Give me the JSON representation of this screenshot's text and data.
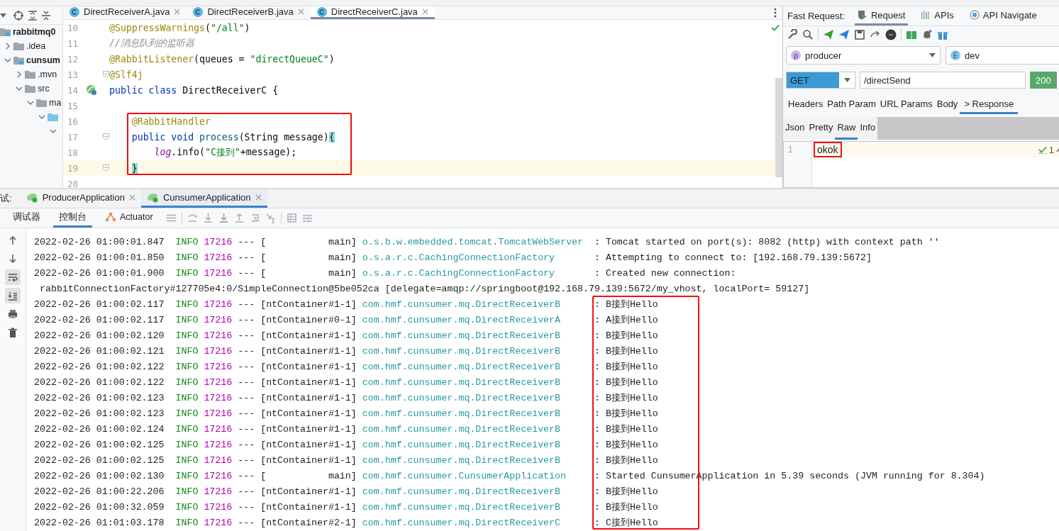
{
  "project_tree": {
    "items": [
      {
        "label": "rabbitmq0",
        "bold": true,
        "kind": "module",
        "children": [
          {
            "label": ".idea",
            "bold": false,
            "kind": "folder",
            "expanded": false
          },
          {
            "label": "cunsum",
            "bold": true,
            "kind": "module",
            "expanded": true,
            "children": [
              {
                "label": ".mvn",
                "bold": false,
                "kind": "folder",
                "expanded": false
              },
              {
                "label": "src",
                "bold": false,
                "kind": "folder",
                "expanded": true,
                "children": [
                  {
                    "label": "ma",
                    "bold": false,
                    "kind": "folder",
                    "expanded": true,
                    "children": [
                      {
                        "kind": "source",
                        "expanded": true,
                        "children": [
                          {
                            "expanded": true
                          }
                        ]
                      }
                    ]
                  }
                ]
              }
            ]
          }
        ]
      }
    ]
  },
  "editor": {
    "tabs": [
      {
        "label": "DirectReceiverA.java",
        "selected": false
      },
      {
        "label": "DirectReceiverB.java",
        "selected": false
      },
      {
        "label": "DirectReceiverC.java",
        "selected": true
      }
    ],
    "lines": [
      {
        "number": "10",
        "current": false,
        "fold": false,
        "gutter_marker": false,
        "tokens": [
          {
            "kind": "annotation",
            "text": "@SuppressWarnings"
          },
          {
            "kind": "plain",
            "text": "("
          },
          {
            "kind": "string",
            "text": "\"/all\""
          },
          {
            "kind": "plain",
            "text": ")"
          }
        ]
      },
      {
        "number": "11",
        "current": false,
        "fold": false,
        "gutter_marker": false,
        "tokens": [
          {
            "kind": "comment",
            "text": "//消息队列的监听器"
          }
        ]
      },
      {
        "number": "12",
        "current": false,
        "fold": false,
        "gutter_marker": false,
        "tokens": [
          {
            "kind": "annotation",
            "text": "@RabbitListener"
          },
          {
            "kind": "plain",
            "text": "(queues = "
          },
          {
            "kind": "string",
            "text": "\"directQueueC\""
          },
          {
            "kind": "plain",
            "text": ")"
          }
        ]
      },
      {
        "number": "13",
        "current": false,
        "fold": true,
        "gutter_marker": false,
        "tokens": [
          {
            "kind": "annotation",
            "text": "@Slf4j"
          }
        ]
      },
      {
        "number": "14",
        "current": false,
        "fold": false,
        "gutter_marker": true,
        "tokens": [
          {
            "kind": "keyword",
            "text": "public class "
          },
          {
            "kind": "plain",
            "text": "DirectReceiverC {"
          }
        ]
      },
      {
        "number": "15",
        "current": false,
        "fold": false,
        "gutter_marker": false
      }
    ],
    "highlighted_lines": [
      {
        "number": "16",
        "current": false,
        "fold": false,
        "gutter_marker": false,
        "tokens": [
          {
            "kind": "annotation",
            "text": "    @RabbitHandler"
          }
        ]
      },
      {
        "number": "17",
        "current": false,
        "fold": true,
        "gutter_marker": false,
        "tokens": [
          {
            "kind": "keyword",
            "text": "    public void "
          },
          {
            "kind": "method",
            "text": "process"
          },
          {
            "kind": "plain",
            "text": "(String message)"
          },
          {
            "kind": "brace",
            "text": "{"
          }
        ]
      },
      {
        "number": "18",
        "current": false,
        "fold": false,
        "gutter_marker": false,
        "tokens": [
          {
            "kind": "field",
            "text": "        log"
          },
          {
            "kind": "plain",
            "text": ".info("
          },
          {
            "kind": "string",
            "text": "\"C接到\""
          },
          {
            "kind": "plain",
            "text": "+message);"
          }
        ]
      },
      {
        "number": "19",
        "current": true,
        "fold": true,
        "gutter_marker": false,
        "tokens": [
          {
            "kind": "brace",
            "text": "    }"
          }
        ]
      }
    ],
    "lines_after": [
      {
        "number": "20",
        "current": false,
        "fold": false,
        "gutter_marker": false
      }
    ]
  },
  "fast_request": {
    "label": "Fast Request:",
    "tabs": [
      {
        "label": "Request",
        "selected": true,
        "kind": "request"
      },
      {
        "label": "APIs",
        "selected": false,
        "kind": "apis"
      },
      {
        "label": "API Navigate",
        "selected": false,
        "kind": "navigate"
      }
    ],
    "project": {
      "badge": "p",
      "value": "producer"
    },
    "environment": {
      "badge": "E",
      "value": "dev"
    },
    "method": "GET",
    "url": "/directSend",
    "send_button": "200",
    "request_tabs": [
      {
        "label": "Headers",
        "selected": false
      },
      {
        "label": "Path Param",
        "selected": false
      },
      {
        "label": "URL Params",
        "selected": false
      },
      {
        "label": "Body",
        "selected": false
      },
      {
        "label": "> Response",
        "selected": true
      }
    ],
    "response_tabs": [
      {
        "label": "Json",
        "selected": false
      },
      {
        "label": "Pretty",
        "selected": false
      },
      {
        "label": "Raw",
        "selected": true
      },
      {
        "label": "Info",
        "selected": false
      }
    ],
    "response": {
      "line_number": "1",
      "text": "okok",
      "highlighted": true,
      "inspection_count": "1"
    }
  },
  "run_panel": {
    "label": "试:",
    "tabs": [
      {
        "label": "ProducerApplication",
        "selected": false
      },
      {
        "label": "CunsumerApplication",
        "selected": true
      }
    ],
    "console_tabs": [
      {
        "label": "调试器",
        "selected": false,
        "kind": "plain"
      },
      {
        "label": "控制台",
        "selected": true,
        "kind": "plain"
      },
      {
        "label": "Actuator",
        "selected": false,
        "kind": "actuator"
      }
    ],
    "lines": [
      {
        "kind": "entry",
        "timestamp": "2022-02-26 01:00:01.847",
        "level": "INFO",
        "pid": "17216",
        "separator": "---",
        "thread": "[           main]",
        "logger": "o.s.b.w.embedded.tomcat.TomcatWebServer",
        "message": ": Tomcat started on port(s): 8082 (http) with context path ''"
      },
      {
        "kind": "entry",
        "timestamp": "2022-02-26 01:00:01.850",
        "level": "INFO",
        "pid": "17216",
        "separator": "---",
        "thread": "[           main]",
        "logger": "o.s.a.r.c.CachingConnectionFactory",
        "message": ": Attempting to connect to: [192.168.79.139:5672]"
      },
      {
        "kind": "entry",
        "timestamp": "2022-02-26 01:00:01.900",
        "level": "INFO",
        "pid": "17216",
        "separator": "---",
        "thread": "[           main]",
        "logger": "o.s.a.r.c.CachingConnectionFactory",
        "message": ": Created new connection:"
      },
      {
        "kind": "continuation",
        "text": "rabbitConnectionFactory#127705e4:0/SimpleConnection@5be052ca [delegate=amqp://springboot@192.168.79.139:5672/my_vhost, localPort= 59127]"
      }
    ],
    "highlighted_lines": [
      {
        "kind": "entry",
        "timestamp": "2022-02-26 01:00:02.117",
        "level": "INFO",
        "pid": "17216",
        "separator": "---",
        "thread": "[ntContainer#1-1]",
        "logger": "com.hmf.cunsumer.mq.DirectReceiverB",
        "message": ": B接到Hello"
      },
      {
        "kind": "entry",
        "timestamp": "2022-02-26 01:00:02.117",
        "level": "INFO",
        "pid": "17216",
        "separator": "---",
        "thread": "[ntContainer#0-1]",
        "logger": "com.hmf.cunsumer.mq.DirectReceiverA",
        "message": ": A接到Hello"
      },
      {
        "kind": "entry",
        "timestamp": "2022-02-26 01:00:02.120",
        "level": "INFO",
        "pid": "17216",
        "separator": "---",
        "thread": "[ntContainer#1-1]",
        "logger": "com.hmf.cunsumer.mq.DirectReceiverB",
        "message": ": B接到Hello"
      },
      {
        "kind": "entry",
        "timestamp": "2022-02-26 01:00:02.121",
        "level": "INFO",
        "pid": "17216",
        "separator": "---",
        "thread": "[ntContainer#1-1]",
        "logger": "com.hmf.cunsumer.mq.DirectReceiverB",
        "message": ": B接到Hello"
      },
      {
        "kind": "entry",
        "timestamp": "2022-02-26 01:00:02.122",
        "level": "INFO",
        "pid": "17216",
        "separator": "---",
        "thread": "[ntContainer#1-1]",
        "logger": "com.hmf.cunsumer.mq.DirectReceiverB",
        "message": ": B接到Hello"
      },
      {
        "kind": "entry",
        "timestamp": "2022-02-26 01:00:02.122",
        "level": "INFO",
        "pid": "17216",
        "separator": "---",
        "thread": "[ntContainer#1-1]",
        "logger": "com.hmf.cunsumer.mq.DirectReceiverB",
        "message": ": B接到Hello"
      },
      {
        "kind": "entry",
        "timestamp": "2022-02-26 01:00:02.123",
        "level": "INFO",
        "pid": "17216",
        "separator": "---",
        "thread": "[ntContainer#1-1]",
        "logger": "com.hmf.cunsumer.mq.DirectReceiverB",
        "message": ": B接到Hello"
      },
      {
        "kind": "entry",
        "timestamp": "2022-02-26 01:00:02.123",
        "level": "INFO",
        "pid": "17216",
        "separator": "---",
        "thread": "[ntContainer#1-1]",
        "logger": "com.hmf.cunsumer.mq.DirectReceiverB",
        "message": ": B接到Hello"
      },
      {
        "kind": "entry",
        "timestamp": "2022-02-26 01:00:02.124",
        "level": "INFO",
        "pid": "17216",
        "separator": "---",
        "thread": "[ntContainer#1-1]",
        "logger": "com.hmf.cunsumer.mq.DirectReceiverB",
        "message": ": B接到Hello"
      },
      {
        "kind": "entry",
        "timestamp": "2022-02-26 01:00:02.125",
        "level": "INFO",
        "pid": "17216",
        "separator": "---",
        "thread": "[ntContainer#1-1]",
        "logger": "com.hmf.cunsumer.mq.DirectReceiverB",
        "message": ": B接到Hello"
      },
      {
        "kind": "entry",
        "timestamp": "2022-02-26 01:00:02.125",
        "level": "INFO",
        "pid": "17216",
        "separator": "---",
        "thread": "[ntContainer#1-1]",
        "logger": "com.hmf.cunsumer.mq.DirectReceiverB",
        "message": ": B接到Hello"
      },
      {
        "kind": "entry",
        "timestamp": "2022-02-26 01:00:02.130",
        "level": "INFO",
        "pid": "17216",
        "separator": "---",
        "thread": "[           main]",
        "logger": "com.hmf.cunsumer.CunsumerApplication",
        "message": ": Started CunsumerApplication in 5.39 seconds (JVM running for 8.304)"
      },
      {
        "kind": "entry",
        "timestamp": "2022-02-26 01:00:22.206",
        "level": "INFO",
        "pid": "17216",
        "separator": "---",
        "thread": "[ntContainer#1-1]",
        "logger": "com.hmf.cunsumer.mq.DirectReceiverB",
        "message": ": B接到Hello"
      },
      {
        "kind": "entry",
        "timestamp": "2022-02-26 01:00:32.059",
        "level": "INFO",
        "pid": "17216",
        "separator": "---",
        "thread": "[ntContainer#1-1]",
        "logger": "com.hmf.cunsumer.mq.DirectReceiverB",
        "message": ": B接到Hello"
      },
      {
        "kind": "entry",
        "timestamp": "2022-02-26 01:01:03.178",
        "level": "INFO",
        "pid": "17216",
        "separator": "---",
        "thread": "[ntContainer#2-1]",
        "logger": "com.hmf.cunsumer.mq.DirectReceiverC",
        "message": ": C接到Hello"
      }
    ]
  }
}
